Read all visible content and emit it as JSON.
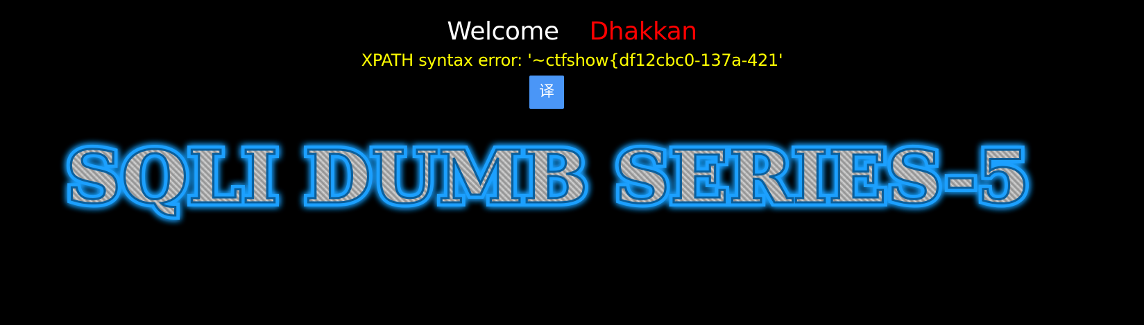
{
  "welcome": {
    "greeting": "Welcome",
    "user": "Dhakkan"
  },
  "error": {
    "message": "XPATH syntax error: '~ctfshow{df12cbc0-137a-421'"
  },
  "translate_button": {
    "label": "译"
  },
  "banner": {
    "text": "SQLI DUMB SERIES-5"
  },
  "colors": {
    "background": "#000000",
    "greeting": "#ffffff",
    "user": "#ff0000",
    "error": "#ffff00",
    "button": "#4a96f7",
    "banner_glow": "#1ea0ff",
    "banner_metal": "#a8a8a8"
  }
}
